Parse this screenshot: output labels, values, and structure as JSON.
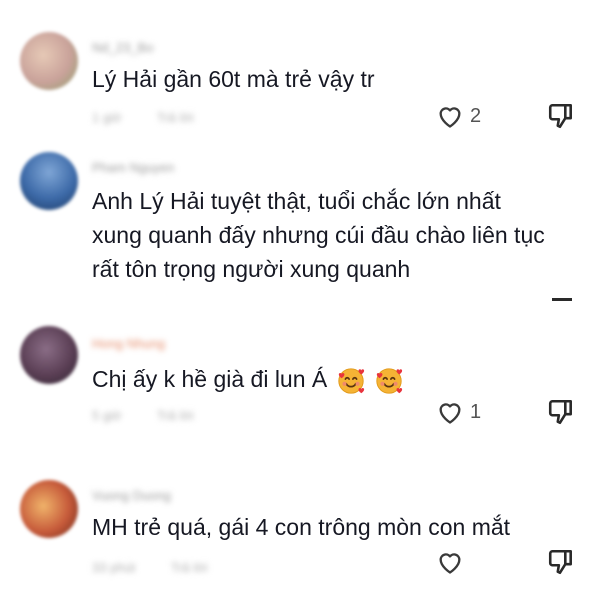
{
  "comments": [
    {
      "username": "Nd_23_Bo",
      "text": "Lý Hải gần 60t mà trẻ vậy tr",
      "time": "1 giờ",
      "reply": "Trả lời",
      "likes": "2",
      "avatar_colors": [
        "#d7b3b0",
        "#e6c9b6"
      ]
    },
    {
      "username": "Pham Nguyen",
      "text": "Anh Lý Hải tuyệt thật, tuổi chắc lớn nhất xung quanh đấy nhưng cúi đầu chào liên tục rất tôn trọng người xung quanh",
      "time": "",
      "reply": "",
      "likes": "",
      "avatar_colors": [
        "#3d6aa8",
        "#1d3b66"
      ]
    },
    {
      "username": "Hong Nhung",
      "text": "Chị ấy k hề già đi lun Á",
      "emojis": [
        "smiling-face-with-hearts-icon",
        "smiling-face-with-hearts-icon"
      ],
      "time": "5 giờ",
      "reply": "Trả lời",
      "likes": "1",
      "avatar_colors": [
        "#5b3f55",
        "#2e2430"
      ]
    },
    {
      "username": "Vuong Duong",
      "text": "MH trẻ quá, gái 4 con trông mòn con mắt",
      "time": "33 phút",
      "reply": "Trả lời",
      "likes": "",
      "avatar_colors": [
        "#c65a3a",
        "#f0b36a"
      ]
    }
  ]
}
